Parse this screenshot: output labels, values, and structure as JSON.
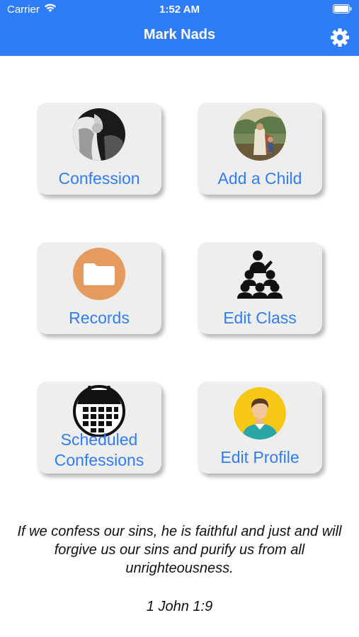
{
  "status_bar": {
    "carrier": "Carrier",
    "time": "1:52 AM"
  },
  "header": {
    "title": "Mark Nads",
    "background_color": "#2f7df6",
    "settings_icon": "gear-icon"
  },
  "tiles": [
    {
      "label": "Confession",
      "icon": "confession-image-icon"
    },
    {
      "label": "Add a Child",
      "icon": "shepherd-image-icon"
    },
    {
      "label": "Records",
      "icon": "folder-icon"
    },
    {
      "label": "Edit Class",
      "icon": "group-icon"
    },
    {
      "label_line1": "Scheduled",
      "label_line2": "Confessions",
      "icon": "calendar-icon"
    },
    {
      "label": "Edit Profile",
      "icon": "profile-icon"
    }
  ],
  "accent_color": "#2f7df6",
  "quote": {
    "text": "If we confess our sins, he is faithful and just and will forgive us our sins and purify us from all unrighteousness.",
    "reference": "1 John 1:9"
  }
}
